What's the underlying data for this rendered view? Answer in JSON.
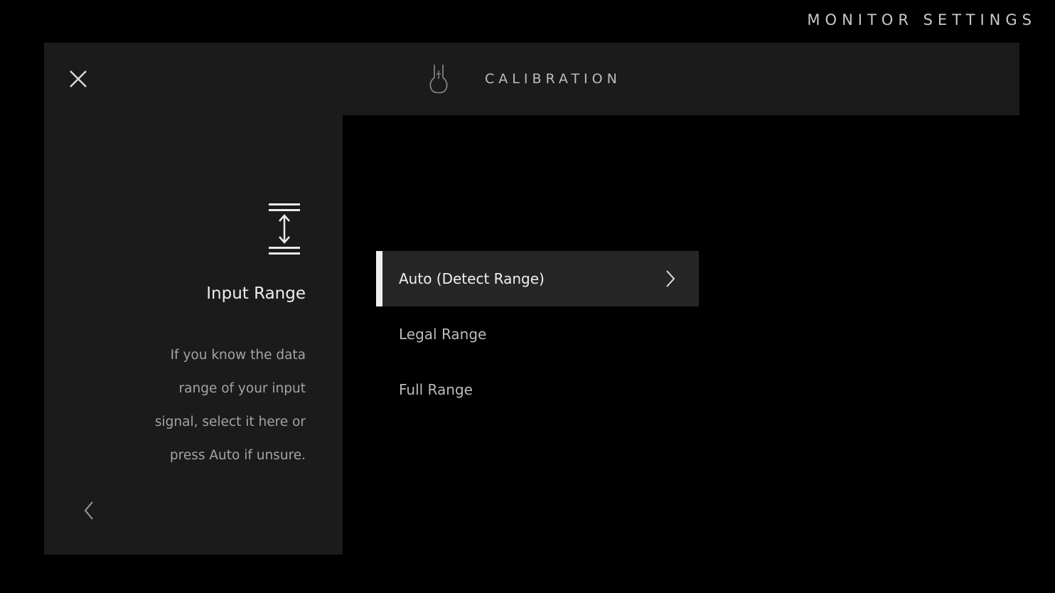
{
  "header": {
    "title": "MONITOR SETTINGS"
  },
  "top_bar": {
    "close_icon": "close-icon",
    "section_icon": "calibration-probe-icon",
    "section_title": "CALIBRATION"
  },
  "left_panel": {
    "icon": "vertical-range-icon",
    "title": "Input Range",
    "description_lines": [
      "If you know the data",
      "range of your input",
      "signal, select it here or",
      "press Auto if unsure."
    ],
    "back_icon": "chevron-left-icon"
  },
  "options": [
    {
      "label": "Auto (Detect Range)",
      "selected": true,
      "chevron_icon": "chevron-right-icon"
    },
    {
      "label": "Legal Range",
      "selected": false
    },
    {
      "label": "Full Range",
      "selected": false
    }
  ],
  "colors": {
    "background": "#000000",
    "panel": "#1b1b1b",
    "selected_row": "#262626",
    "accent_bar": "#eeeeee"
  }
}
